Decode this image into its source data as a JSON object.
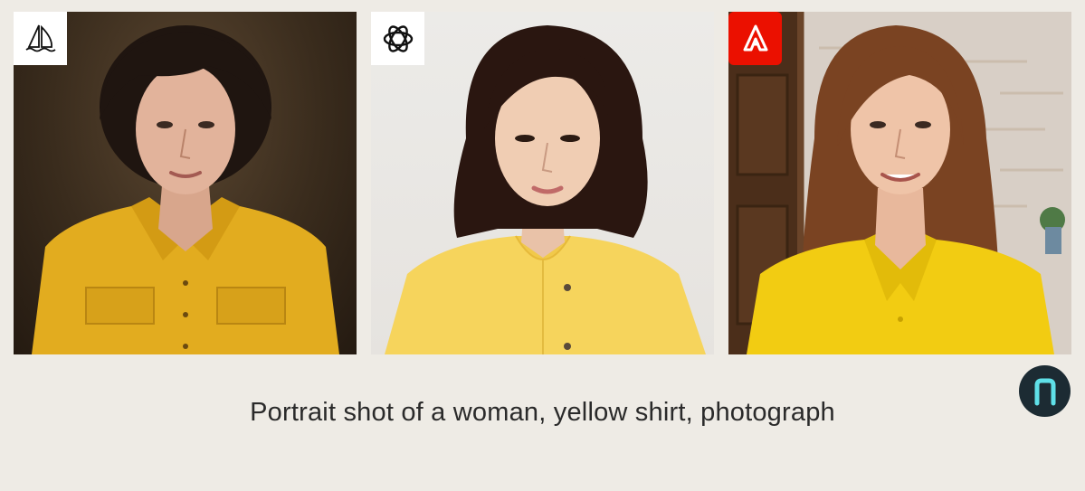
{
  "caption": "Portrait shot of a woman, yellow shirt, photograph",
  "panels": [
    {
      "logo_icon": "midjourney-sailboat-icon",
      "shirt_color": "#e2ac1f",
      "hair_color": "#1f1510"
    },
    {
      "logo_icon": "openai-knot-icon",
      "shirt_color": "#f6d45c",
      "hair_color": "#2a1610"
    },
    {
      "logo_icon": "adobe-firefly-icon",
      "shirt_color": "#f2cc12",
      "hair_color": "#7a4322"
    }
  ],
  "corner_logo_icon": "n-monogram-icon",
  "colors": {
    "background": "#eeebe5",
    "adobe_red": "#eb1000",
    "corner_logo_bg": "#1c2b33",
    "corner_logo_fg": "#5fe0e8"
  }
}
